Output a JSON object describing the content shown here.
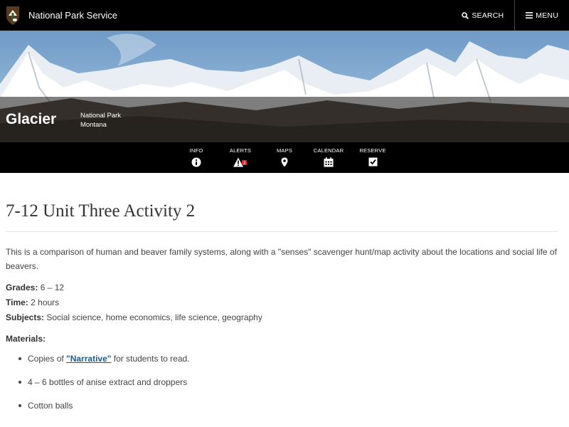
{
  "header": {
    "site_name": "National Park Service",
    "search_label": "SEARCH",
    "menu_label": "MENU"
  },
  "park": {
    "name": "Glacier",
    "designation": "National Park",
    "state": "Montana"
  },
  "subnav": {
    "items": [
      {
        "label": "INFO",
        "icon": "info-icon"
      },
      {
        "label": "ALERTS",
        "icon": "alert-icon",
        "badge": "2"
      },
      {
        "label": "MAPS",
        "icon": "map-pin-icon"
      },
      {
        "label": "CALENDAR",
        "icon": "calendar-icon"
      },
      {
        "label": "RESERVE",
        "icon": "checkbox-icon"
      }
    ]
  },
  "article": {
    "title": "7-12 Unit Three Activity 2",
    "description": "This is a comparison of human and beaver family systems, along with a \"senses\" scavenger hunt/map activity about the locations and social life of beavers.",
    "grades_label": "Grades:",
    "grades_value": " 6 – 12",
    "time_label": "Time:",
    "time_value": " 2 hours",
    "subjects_label": "Subjects:",
    "subjects_value": " Social science, home economics, life science, geography",
    "materials_label": "Materials:",
    "materials": {
      "item1_prefix": "Copies of ",
      "item1_link": "\"Narrative\"",
      "item1_suffix": " for students to read.",
      "item2": "4 – 6 bottles of anise extract and droppers",
      "item3": "Cotton balls"
    }
  },
  "colors": {
    "header_bg": "#000000",
    "link": "#1f5a8a",
    "alert_badge": "#e02020"
  }
}
